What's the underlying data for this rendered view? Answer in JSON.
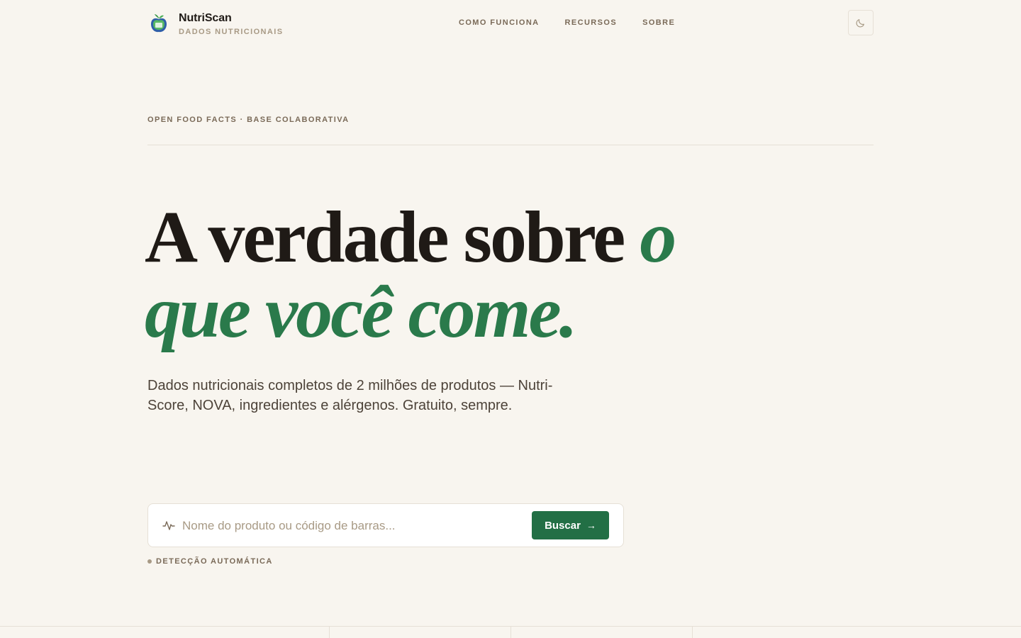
{
  "brand": {
    "name": "NutriScan",
    "subtitle": "DADOS NUTRICIONAIS",
    "logo_icon": "apple-icon"
  },
  "nav": {
    "items": [
      {
        "label": "COMO FUNCIONA"
      },
      {
        "label": "RECURSOS"
      },
      {
        "label": "SOBRE"
      }
    ]
  },
  "theme_toggle": {
    "icon": "moon-icon"
  },
  "hero": {
    "eyebrow": "OPEN FOOD FACTS · BASE COLABORATIVA",
    "headline_part1": "A verdade sobre ",
    "headline_accent_1": "o",
    "headline_accent_2": "que você come.",
    "lead": "Dados nutricionais completos de 2 milhões de produtos — Nutri-Score, NOVA, ingredientes e alérgenos. Gratuito, sempre."
  },
  "search": {
    "icon": "pulse-icon",
    "placeholder": "Nome do produto ou código de barras...",
    "value": "",
    "button_label": "Buscar",
    "button_arrow": "→",
    "hint": "DETECÇÃO AUTOMÁTICA"
  },
  "colors": {
    "background": "#f8f5ef",
    "accent": "#2a7a4b",
    "button": "#226f45",
    "muted": "#7a6a58"
  }
}
